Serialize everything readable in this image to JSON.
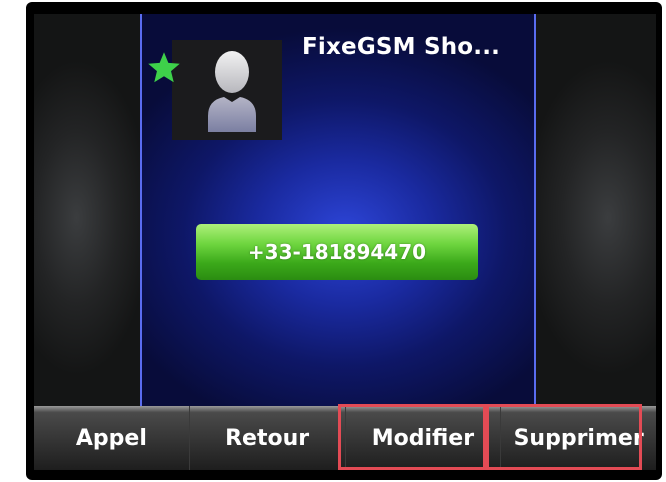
{
  "contact": {
    "name": "FixeGSM Sho...",
    "favorite": true,
    "number": "+33-181894470"
  },
  "softkeys": [
    {
      "label": "Appel"
    },
    {
      "label": "Retour"
    },
    {
      "label": "Modifier"
    },
    {
      "label": "Supprimer"
    }
  ],
  "highlighted_softkeys": [
    "Modifier",
    "Supprimer"
  ],
  "colors": {
    "background": "#141a7a",
    "favorite_star": "#3ed14a",
    "number_button": "#4cc021",
    "highlight": "#e34b55",
    "divider": "#5a6cf0"
  },
  "icons": {
    "avatar": "person-silhouette-icon",
    "favorite": "star-icon"
  }
}
